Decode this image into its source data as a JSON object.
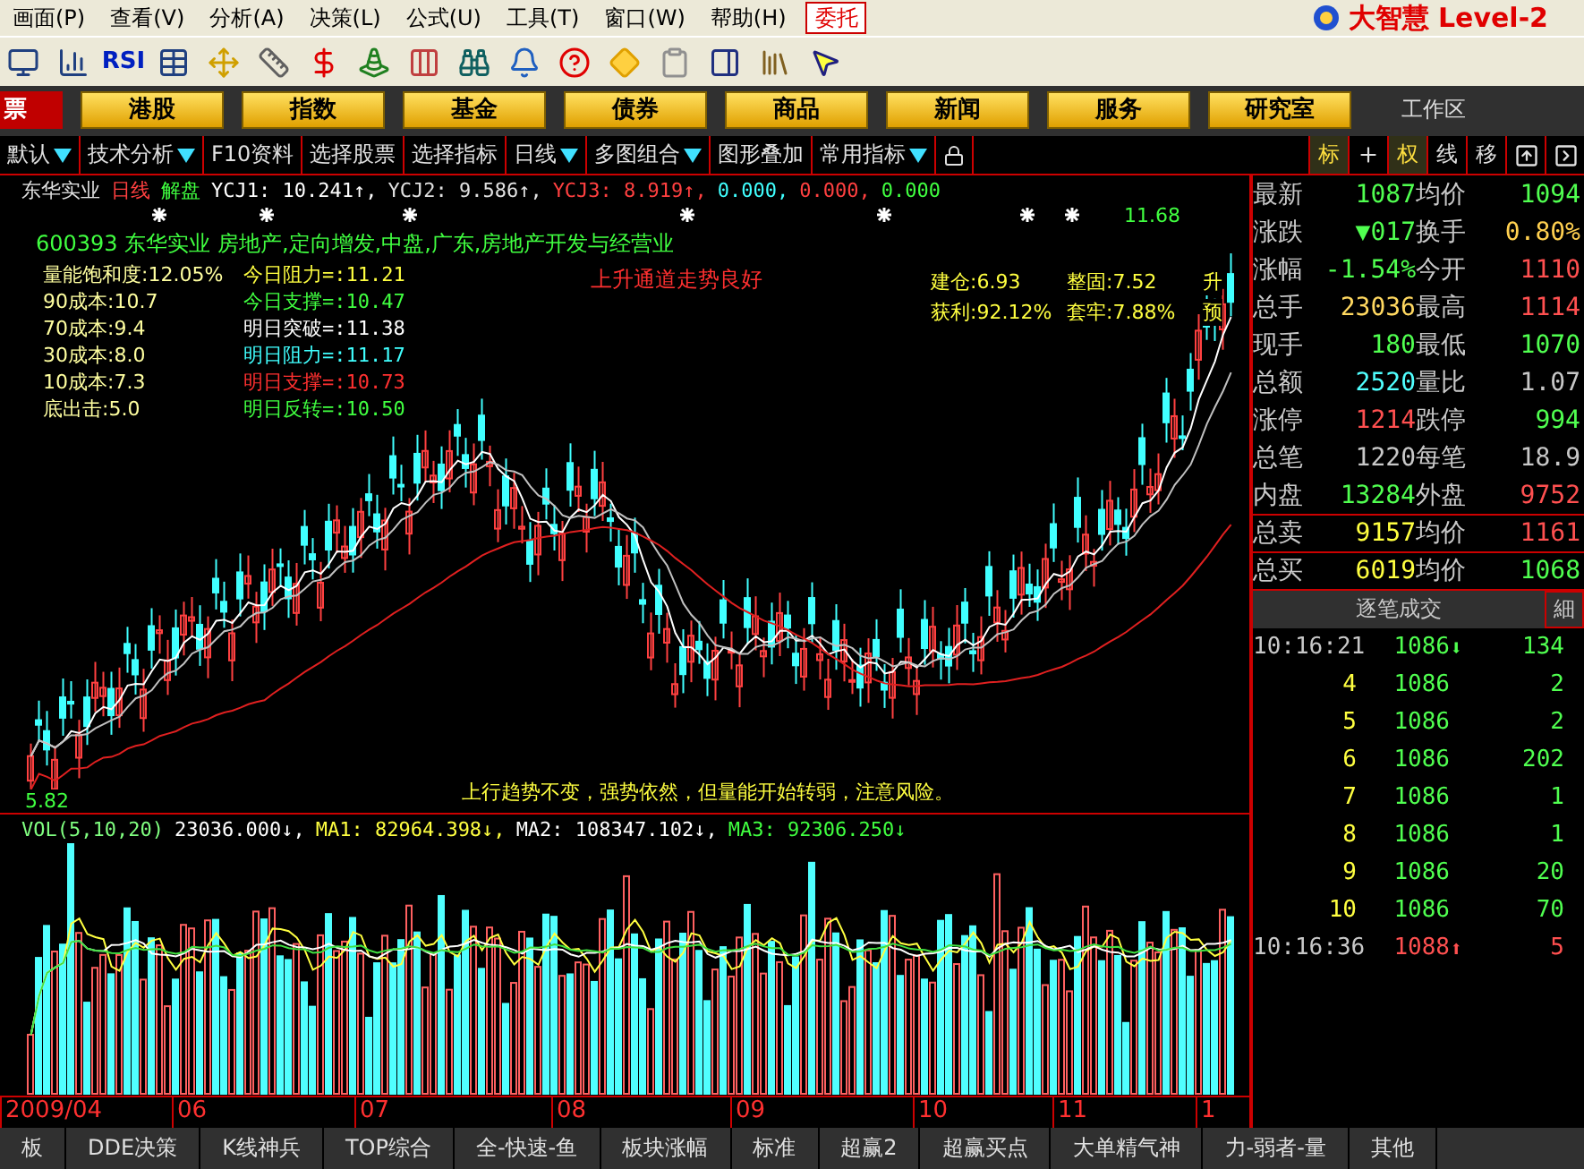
{
  "menu": {
    "items": [
      "画面(P)",
      "查看(V)",
      "分析(A)",
      "决策(L)",
      "公式(U)",
      "工具(T)",
      "窗口(W)",
      "帮助(H)"
    ],
    "trade_button": "委托",
    "logo": "大智慧 Level-2"
  },
  "toolbar": {
    "label_icon": "RSI"
  },
  "nav": {
    "left": "票",
    "buttons": [
      "港股",
      "指数",
      "基金",
      "债券",
      "商品",
      "新闻",
      "服务",
      "研究室"
    ],
    "workspace": "工作区"
  },
  "tabs": [
    {
      "label": "默认",
      "dropdown": true
    },
    {
      "label": "技术分析",
      "dropdown": true
    },
    {
      "label": "F10资料",
      "dropdown": false
    },
    {
      "label": "选择股票",
      "dropdown": false
    },
    {
      "label": "选择指标",
      "dropdown": false
    },
    {
      "label": "日线",
      "dropdown": true
    },
    {
      "label": "多图组合",
      "dropdown": true
    },
    {
      "label": "图形叠加",
      "dropdown": false
    },
    {
      "label": "常用指标",
      "dropdown": true
    }
  ],
  "right_tabs": [
    {
      "label": "标",
      "selected": true
    },
    {
      "label": "权",
      "selected": true
    },
    {
      "label": "线",
      "selected": false
    },
    {
      "label": "移",
      "selected": false
    }
  ],
  "chart": {
    "header": [
      {
        "text": "东华实业",
        "color": "#e0e0e0"
      },
      {
        "text": "日线",
        "color": "#ff4040"
      },
      {
        "text": "解盘",
        "color": "#40ff40"
      },
      {
        "text": "YCJ1: 10.241↑,",
        "color": "#ffffff"
      },
      {
        "text": "YCJ2: 9.586↑,",
        "color": "#e0e0e0"
      },
      {
        "text": "YCJ3: 8.919↑,",
        "color": "#ff4040"
      },
      {
        "text": "0.000,",
        "color": "#40ffff"
      },
      {
        "text": "0.000,",
        "color": "#ff4040"
      },
      {
        "text": "0.000",
        "color": "#40ff40"
      }
    ],
    "info": "600393 东华实业 房地产,定向增发,中盘,广东,房地产开发与经营业",
    "costs": [
      "量能饱和度:12.05%",
      "90成本:10.7",
      "70成本:9.4",
      "30成本:8.0",
      "10成本:7.3",
      "底出击:5.0"
    ],
    "levels": [
      {
        "text": "今日阻力=:11.21",
        "color": "#ffff40"
      },
      {
        "text": "今日支撑=:10.47",
        "color": "#40ff40"
      },
      {
        "text": "明日突破=:11.38",
        "color": "#ffffff"
      },
      {
        "text": "明日阻力=:11.17",
        "color": "#40ffff"
      },
      {
        "text": "明日支撑=:10.73",
        "color": "#ff3030"
      },
      {
        "text": "明日反转=:10.50",
        "color": "#40ff40"
      }
    ],
    "trend_note": "上升通道走势良好",
    "stats": [
      "建仓:6.93",
      "整固:7.52",
      "升",
      "获利:92.12%",
      "套牢:7.88%",
      "预"
    ],
    "high_label": "11.68",
    "low_label": "5.82",
    "comment": "上行趋势不变，强势依然，但量能开始转弱，注意风险。"
  },
  "volume": {
    "header": [
      {
        "text": "VOL(5,10,20)",
        "color": "#80ff80"
      },
      {
        "text": "23036.000↓,",
        "color": "#ffffff"
      },
      {
        "text": "MA1: 82964.398↓,",
        "color": "#ffff40"
      },
      {
        "text": "MA2: 108347.102↓,",
        "color": "#ffffff"
      },
      {
        "text": "MA3: 92306.250↓",
        "color": "#40ff40"
      }
    ],
    "dates": [
      "2009/04",
      "06",
      "07",
      "08",
      "09",
      "10",
      "11",
      "1"
    ]
  },
  "quote": [
    {
      "boxed": false,
      "cells": [
        {
          "label": "最新",
          "value": "1087",
          "color": "#50ff50"
        },
        {
          "label": "均价",
          "value": "1094",
          "color": "#50ff50"
        }
      ]
    },
    {
      "boxed": false,
      "cells": [
        {
          "label": "涨跌",
          "value": "▼017",
          "color": "#50ff50"
        },
        {
          "label": "换手",
          "value": "0.80%",
          "color": "#ffd050"
        }
      ]
    },
    {
      "boxed": false,
      "cells": [
        {
          "label": "涨幅",
          "value": "-1.54%",
          "color": "#50ff50"
        },
        {
          "label": "今开",
          "value": "1110",
          "color": "#ff5050"
        }
      ]
    },
    {
      "boxed": false,
      "cells": [
        {
          "label": "总手",
          "value": "23036",
          "color": "#ffd860"
        },
        {
          "label": "最高",
          "value": "1114",
          "color": "#ff5050"
        }
      ]
    },
    {
      "boxed": false,
      "cells": [
        {
          "label": "现手",
          "value": "180",
          "color": "#50ff50"
        },
        {
          "label": "最低",
          "value": "1070",
          "color": "#50ff50"
        }
      ]
    },
    {
      "boxed": false,
      "cells": [
        {
          "label": "总额",
          "value": "2520",
          "color": "#50ffff"
        },
        {
          "label": "量比",
          "value": "1.07",
          "color": "#c8c8c8"
        }
      ]
    },
    {
      "boxed": false,
      "cells": [
        {
          "label": "涨停",
          "value": "1214",
          "color": "#ff5050"
        },
        {
          "label": "跌停",
          "value": "994",
          "color": "#50ff50"
        }
      ]
    },
    {
      "boxed": false,
      "cells": [
        {
          "label": "总笔",
          "value": "1220",
          "color": "#c8c8c8"
        },
        {
          "label": "每笔",
          "value": "18.9",
          "color": "#c8c8c8"
        }
      ]
    },
    {
      "boxed": false,
      "cells": [
        {
          "label": "内盘",
          "value": "13284",
          "color": "#50ff50"
        },
        {
          "label": "外盘",
          "value": "9752",
          "color": "#ff5050"
        }
      ]
    },
    {
      "boxed": true,
      "cells": [
        {
          "label": "总卖",
          "value": "9157",
          "color": "#ffff40"
        },
        {
          "label": "均价",
          "value": "1161",
          "color": "#ff5050"
        }
      ]
    },
    {
      "boxed": true,
      "cells": [
        {
          "label": "总买",
          "value": "6019",
          "color": "#ffff40"
        },
        {
          "label": "均价",
          "value": "1068",
          "color": "#50ff50"
        }
      ]
    }
  ],
  "ticks": {
    "title": "逐笔成交",
    "detail": "細",
    "rows": [
      {
        "kind": "time",
        "time": "10:16:21",
        "price": "1086",
        "arrow": "⬇",
        "volume": "134",
        "color": "#50ff50"
      },
      {
        "kind": "count",
        "time": "4",
        "price": "1086",
        "volume": "2",
        "color": "#50ff50"
      },
      {
        "kind": "count",
        "time": "5",
        "price": "1086",
        "volume": "2",
        "color": "#50ff50"
      },
      {
        "kind": "count",
        "time": "6",
        "price": "1086",
        "volume": "202",
        "color": "#50ff50"
      },
      {
        "kind": "count",
        "time": "7",
        "price": "1086",
        "volume": "1",
        "color": "#50ff50"
      },
      {
        "kind": "count",
        "time": "8",
        "price": "1086",
        "volume": "1",
        "color": "#50ff50"
      },
      {
        "kind": "count",
        "time": "9",
        "price": "1086",
        "volume": "20",
        "color": "#50ff50"
      },
      {
        "kind": "count",
        "time": "10",
        "price": "1086",
        "volume": "70",
        "color": "#50ff50"
      },
      {
        "kind": "time",
        "time": "10:16:36",
        "price": "1088",
        "arrow": "⬆",
        "volume": "5",
        "color": "#ff5050"
      }
    ]
  },
  "bottom_tabs": [
    "板",
    "DDE决策",
    "K线神兵",
    "TOP综合",
    "全-快速-鱼",
    "板块涨幅",
    "标准",
    "超赢2",
    "超赢买点",
    "大单精气神",
    "力-弱者-量",
    "其他"
  ]
}
